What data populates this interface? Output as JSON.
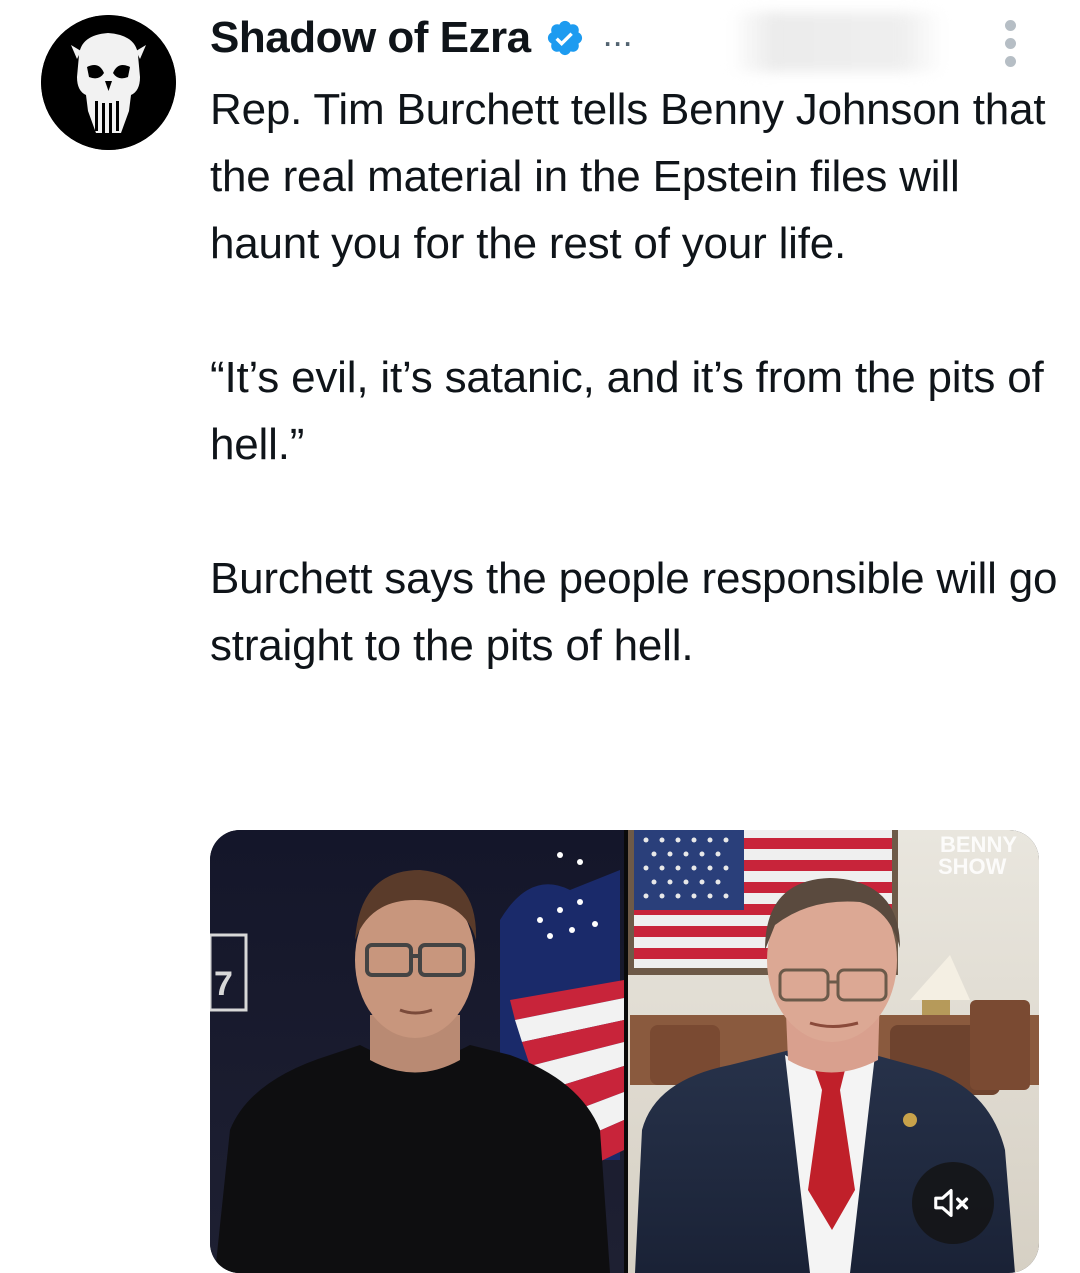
{
  "author": {
    "display_name": "Shadow of Ezra",
    "verified": true,
    "header_ellipsis": "...",
    "avatar_icon": "punisher-skull-icon"
  },
  "tweet": {
    "paragraphs": [
      "Rep. Tim Burchett tells Benny Johnson that the real material in the Epstein files will haunt you for the rest of your life.",
      "“It’s evil, it’s satanic, and it’s from the pits of hell.”",
      "Burchett says the people responsible will go straight to the pits of hell."
    ]
  },
  "media": {
    "watermark_line1": "BENNY",
    "watermark_line2": "SHOW",
    "left_corner_label": "7",
    "mute_icon": "volume-muted-icon"
  },
  "colors": {
    "text": "#0f1419",
    "verified_blue": "#1d9bf0",
    "secondary": "#536471",
    "more_dots": "#b6bec5"
  }
}
